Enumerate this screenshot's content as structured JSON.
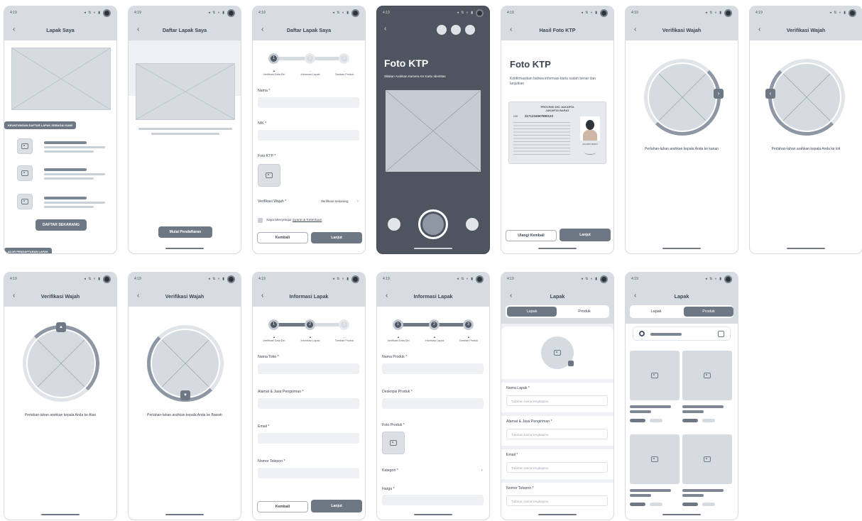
{
  "status": {
    "time": "4:19",
    "icons": "◂ ⇅ ◐ ▮"
  },
  "common": {
    "back": "‹"
  },
  "s1": {
    "title": "Lapak Saya",
    "tag1": "KEUNTUNGAN DAFTAR LAPAK SEBAGAI KAMI",
    "button": "DAFTAR SEKARANG",
    "tag2": "ALUR PENDAFTARAN LAPAK"
  },
  "s2": {
    "title": "Daftar Lapak Saya",
    "button": "Mulai Pendaftaran"
  },
  "s3": {
    "title": "Daftar Lapak Saya",
    "steps": [
      "Verifikasi Data Diri",
      "Informasi Lapak",
      "Tambah Produk"
    ],
    "nama": "Nama *",
    "nik": "NIK *",
    "foto": "Foto KTP *",
    "verif": "Verifikasi Wajah *",
    "verif_action": "Verifikasi Sekarang",
    "agree_pre": "Saya Menyetujui ",
    "agree_link": "Syarat & Ketentuan",
    "back_btn": "Kembali",
    "next_btn": "Lanjut"
  },
  "s4": {
    "title": "Foto KTP",
    "subtitle": "Silakan Arahkan Kamera Ke Kartu Identitas"
  },
  "s5": {
    "title": "Hasil Foto KTP",
    "heading": "Foto KTP",
    "desc": "Konfirmasikan bahwa informasi kartu sudah benar dan lanjutkan",
    "ktp_prov": "PROVINSI DKI JAKARTA",
    "ktp_city": "JAKARTA BARAT",
    "ktp_nik": "3171234567890123",
    "ktp_nik_label": "NIK",
    "ktp_sign_city": "JAKARTA BARAT",
    "retake": "Ulangi Kembali",
    "next": "Lanjut"
  },
  "s6": {
    "title": "Verifikasi Wajah",
    "caption": "Perlahan-lahan arahkan kepala Anda ke kanan"
  },
  "s7": {
    "title": "Verifikasi Wajah",
    "caption": "Perlahan-lahan arahkan kepala Anda ke kiri"
  },
  "s8": {
    "title": "Verifikasi Wajah",
    "caption": "Perlahan-lahan arahkan kepala Anda ke Atas"
  },
  "s9": {
    "title": "Verifikasi Wajah",
    "caption": "Perlahan-lahan arahkan kepala Anda ke Bawah"
  },
  "s10": {
    "title": "Informasi Lapak",
    "toko": "Nama Toko *",
    "alamat": "Alamat & Jasa Pengiriman *",
    "email": "Email *",
    "telp": "Nomor Telepon *",
    "back_btn": "Kembali",
    "next_btn": "Lanjut"
  },
  "s11": {
    "title": "Informasi Lapak",
    "produk": "Nama Produk *",
    "desk": "Deskripsi Produk *",
    "foto": "Foto Produk *",
    "kategori": "Kategori *",
    "harga": "Harga *"
  },
  "s12": {
    "title": "Lapak",
    "tab1": "Lapak",
    "tab2": "Produk",
    "nama": "Nama Lapak *",
    "alamat": "Alamat & Jasa Pengiriman *",
    "email": "Email *",
    "telp": "Nomor Telepon *",
    "placeholder": "Tuliskan nama lengkapmu"
  },
  "s13": {
    "title": "Lapak",
    "tab1": "Lapak",
    "tab2": "Produk"
  }
}
